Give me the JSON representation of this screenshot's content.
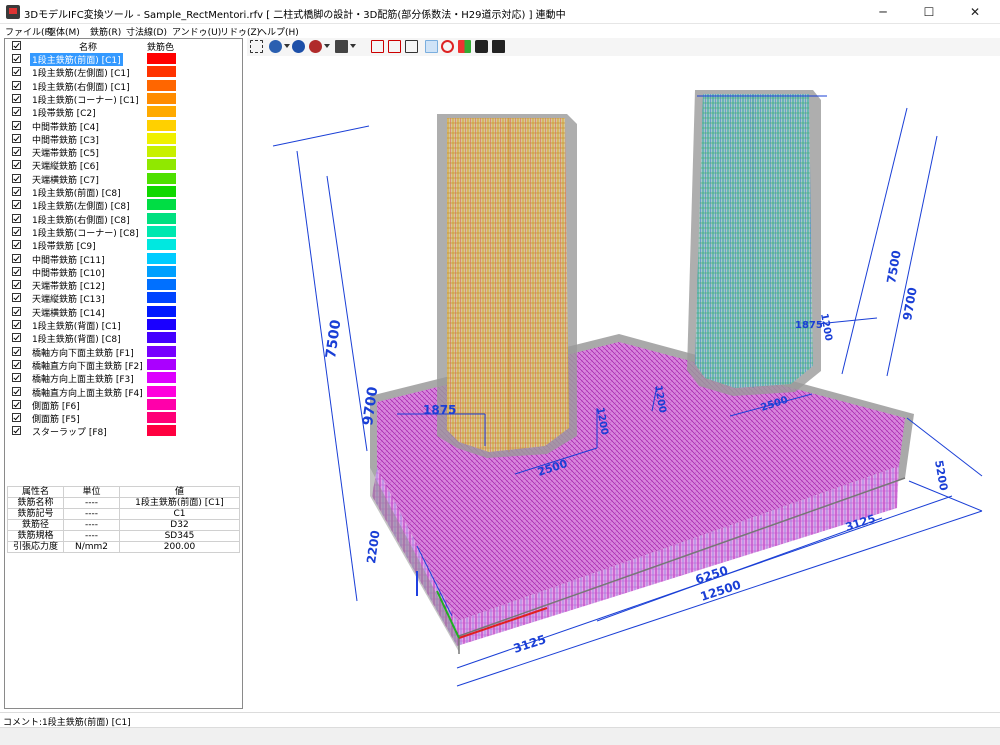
{
  "window": {
    "title": "3DモデルIFC変換ツール - Sample_RectMentori.rfv [ 二柱式橋脚の設計・3D配筋(部分係数法・H29道示対応) ] 連動中",
    "controls": [
      "─",
      "☐",
      "✕"
    ]
  },
  "menu": [
    "ファイル(F)",
    "躯体(M)",
    "鉄筋(R)",
    "寸法線(D)",
    "アンドゥ(U)",
    "リドゥ(Z)",
    "ヘルプ(H)"
  ],
  "rebar_list": {
    "col_name": "名称",
    "col_color": "鉄筋色",
    "items": [
      {
        "name": "1段主鉄筋(前面) [C1]",
        "color": "#ff0000"
      },
      {
        "name": "1段主鉄筋(左側面) [C1]",
        "color": "#ff3300"
      },
      {
        "name": "1段主鉄筋(右側面) [C1]",
        "color": "#ff6600"
      },
      {
        "name": "1段主鉄筋(コーナー) [C1]",
        "color": "#ff8c00"
      },
      {
        "name": "1段帯鉄筋 [C2]",
        "color": "#ffaa00"
      },
      {
        "name": "中間帯鉄筋 [C4]",
        "color": "#ffd000"
      },
      {
        "name": "中間帯鉄筋 [C3]",
        "color": "#f0f000"
      },
      {
        "name": "天端帯鉄筋 [C5]",
        "color": "#c8f000"
      },
      {
        "name": "天端縦鉄筋 [C6]",
        "color": "#90e800"
      },
      {
        "name": "天端横鉄筋 [C7]",
        "color": "#4ee000"
      },
      {
        "name": "1段主鉄筋(前面) [C8]",
        "color": "#10d800"
      },
      {
        "name": "1段主鉄筋(左側面) [C8]",
        "color": "#00dd44"
      },
      {
        "name": "1段主鉄筋(右側面) [C8]",
        "color": "#00e080"
      },
      {
        "name": "1段主鉄筋(コーナー) [C8]",
        "color": "#00e8b0"
      },
      {
        "name": "1段帯鉄筋 [C9]",
        "color": "#00e8e0"
      },
      {
        "name": "中間帯鉄筋 [C11]",
        "color": "#00ccff"
      },
      {
        "name": "中間帯鉄筋 [C10]",
        "color": "#00a0ff"
      },
      {
        "name": "天端帯鉄筋 [C12]",
        "color": "#0070ff"
      },
      {
        "name": "天端縦鉄筋 [C13]",
        "color": "#0044ff"
      },
      {
        "name": "天端横鉄筋 [C14]",
        "color": "#0018ff"
      },
      {
        "name": "1段主鉄筋(背面) [C1]",
        "color": "#1a00ff"
      },
      {
        "name": "1段主鉄筋(背面) [C8]",
        "color": "#4400ff"
      },
      {
        "name": "橋軸方向下面主鉄筋 [F1]",
        "color": "#7700ff"
      },
      {
        "name": "橋軸直方向下面主鉄筋 [F2]",
        "color": "#aa00ff"
      },
      {
        "name": "橋軸方向上面主鉄筋 [F3]",
        "color": "#dd00ff"
      },
      {
        "name": "橋軸直方向上面主鉄筋 [F4]",
        "color": "#ff00dd"
      },
      {
        "name": "側面筋 [F6]",
        "color": "#ff00aa"
      },
      {
        "name": "側面筋 [F5]",
        "color": "#ff0077"
      },
      {
        "name": "スターラップ [F8]",
        "color": "#ff0040"
      }
    ]
  },
  "properties": {
    "headers": [
      "属性名",
      "単位",
      "値"
    ],
    "rows": [
      [
        "鉄筋名称",
        "----",
        "1段主鉄筋(前面) [C1]"
      ],
      [
        "鉄筋記号",
        "----",
        "C1"
      ],
      [
        "鉄筋径",
        "----",
        "D32"
      ],
      [
        "鉄筋規格",
        "----",
        "SD345"
      ],
      [
        "引張応力度",
        "N/mm2",
        "200.00"
      ]
    ]
  },
  "dimensions": {
    "col_height_1": "7500",
    "total_height_1": "9700",
    "col_height_2": "7500",
    "total_height_2": "9700",
    "col_width_left": "1875",
    "col_depth_left": "2500",
    "col_thick_left": "1200",
    "col_width_right": "1875",
    "col_depth_right": "2500",
    "col_thick_right": "1200",
    "footing_height": "2200",
    "footing_depth": "5200",
    "half_width_a": "3125",
    "half_width_b": "6250",
    "full_width": "12500",
    "front_offset": "3125"
  },
  "status": {
    "comment": "コメント:1段主鉄筋(前面) [C1]"
  },
  "colors": {
    "selection": "#3399ff",
    "dimension": "#1a3fd6",
    "footing_rebar": "#c832c8",
    "concrete": "#8c8c8c"
  }
}
